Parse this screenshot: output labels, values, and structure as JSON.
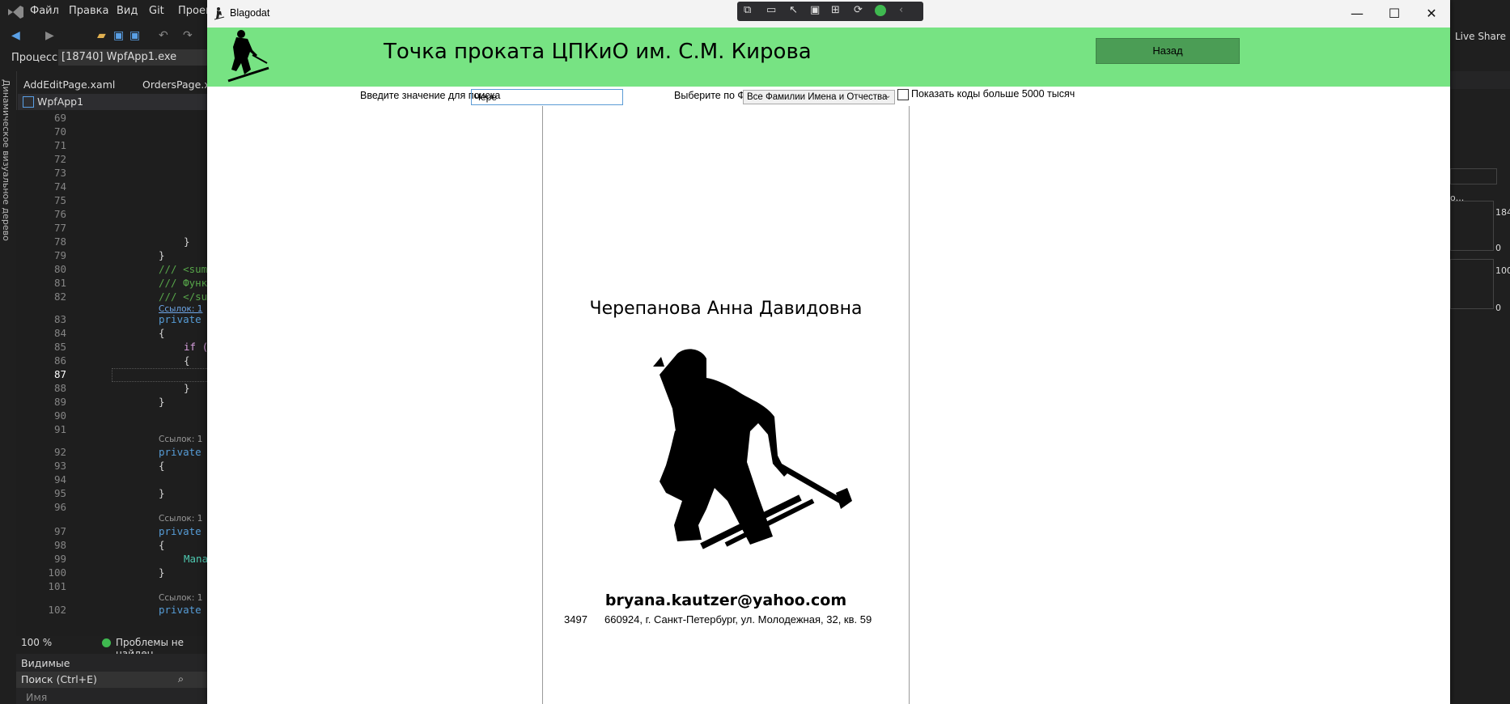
{
  "vs": {
    "menu": [
      "Файл",
      "Правка",
      "Вид",
      "Git",
      "Проек"
    ],
    "process_label": "Процесс:",
    "process_value": "[18740] WpfApp1.exe",
    "tabs": [
      "AddEditPage.xaml",
      "OrdersPage.xaml"
    ],
    "solution": "WpfApp1",
    "left_panel_title": "Динамическое визуальное дерево",
    "line_numbers": [
      "69",
      "70",
      "71",
      "72",
      "73",
      "74",
      "75",
      "76",
      "77",
      "78",
      "79",
      "80",
      "81",
      "82",
      "83",
      "84",
      "85",
      "86",
      "87",
      "88",
      "89",
      "90",
      "91",
      "92",
      "93",
      "94",
      "95",
      "96",
      "97",
      "98",
      "99",
      "100",
      "101",
      "102"
    ],
    "code": {
      "l78": "}",
      "l79": "}",
      "l80": "/// <sum",
      "l81": "/// Функ",
      "l82": "/// </su",
      "ref1": "Ссылок: 1",
      "l83": "private",
      "l84": "{",
      "l85": "if (",
      "l86": "{",
      "l89": "}",
      "l90": "}",
      "ref2": "Ссылок: 1",
      "l92": "private",
      "l93": "{",
      "l95": "}",
      "ref3": "Ссылок: 1",
      "l97": "private",
      "l98": "{",
      "l99": "Mana",
      "l100": "}",
      "ref4": "Ссылок: 1",
      "l102": "private"
    },
    "zoom": "100 %",
    "status": "Проблемы не найден",
    "bottom_title": "Видимые",
    "bottom_search": "Поиск (Ctrl+E)",
    "bottom_column": "Имя",
    "live_share": "Live Share",
    "right_values": [
      "184",
      "0",
      "100",
      "0"
    ],
    "right_text": "о..."
  },
  "app": {
    "window_title": "Blagodat",
    "header_title": "Точка проката ЦПКиО им. С.М. Кирова",
    "back_button": "Назад",
    "search_label": "Введите значение для поиска",
    "search_value": "Чере",
    "fio_label": "Выберите по ФИО",
    "fio_selected": "Все Фамилии Имена и Отчества",
    "checkbox_label": "Показать коды больше 5000 тысяч",
    "client": {
      "name": "Черепанова Анна Давидовна",
      "email": "bryana.kautzer@yahoo.com",
      "code": "3497",
      "address": "660924, г. Санкт-Петербург, ул. Молодежная, 32, кв. 59"
    }
  },
  "colors": {
    "header": "#77e383",
    "back_button": "#4b9d55",
    "vs_bg": "#1f1f1f"
  },
  "icons": [
    "vs-logo-icon",
    "skier-logo-icon",
    "minimize-icon",
    "maximize-icon",
    "close-icon",
    "chevron-down-icon",
    "search-icon"
  ]
}
